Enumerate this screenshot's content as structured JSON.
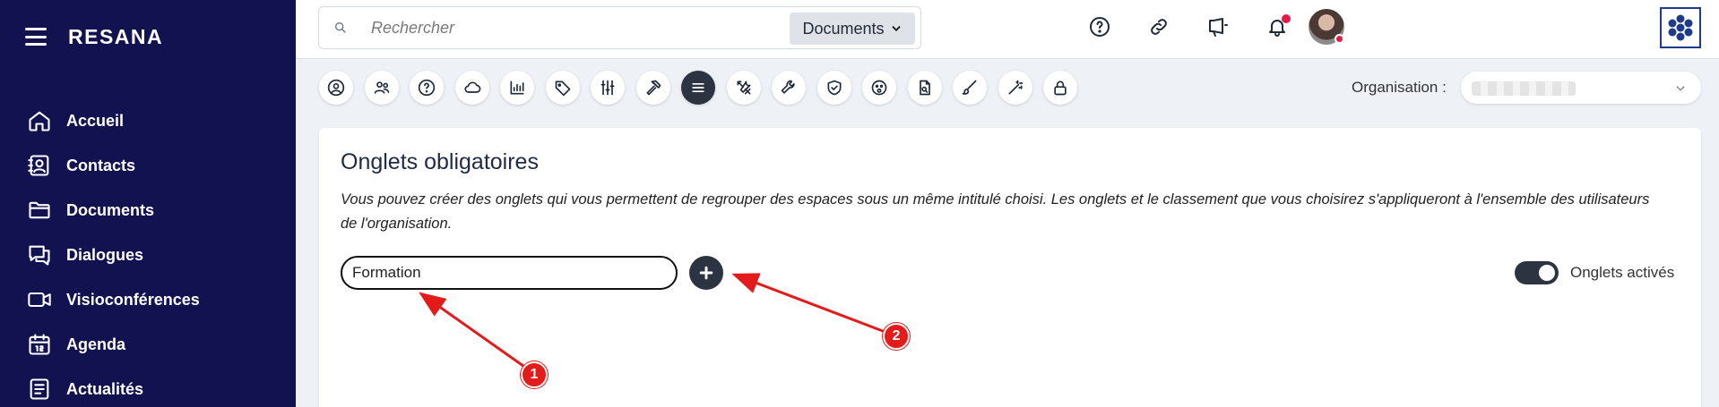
{
  "sidebar": {
    "brand": "RESANA",
    "items": [
      {
        "label": "Accueil",
        "icon": "home-icon"
      },
      {
        "label": "Contacts",
        "icon": "contacts-icon"
      },
      {
        "label": "Documents",
        "icon": "folder-icon"
      },
      {
        "label": "Dialogues",
        "icon": "chat-icon"
      },
      {
        "label": "Visioconférences",
        "icon": "video-icon"
      },
      {
        "label": "Agenda",
        "icon": "calendar-icon"
      },
      {
        "label": "Actualités",
        "icon": "news-icon"
      }
    ]
  },
  "topbar": {
    "search_placeholder": "Rechercher",
    "search_scope": "Documents",
    "icons": [
      "help-icon",
      "link-icon",
      "megaphone-icon",
      "bell-icon"
    ]
  },
  "toolbar": {
    "icons": [
      "user-icon",
      "users-icon",
      "help-icon",
      "cloud-icon",
      "chart-icon",
      "tag-icon",
      "sliders-icon",
      "hammer-icon",
      "list-icon",
      "tools-icon",
      "wrench-icon",
      "shield-check-icon",
      "face-icon",
      "file-search-icon",
      "brush-icon",
      "magic-wand-icon",
      "lock-icon"
    ],
    "active_index": 8
  },
  "organisation": {
    "label": "Organisation :"
  },
  "card": {
    "title": "Onglets obligatoires",
    "description": "Vous pouvez créer des onglets qui vous permettent de regrouper des espaces sous un même intitulé choisi. Les onglets et le classement que vous choisirez s'appliqueront à l'ensemble des utilisateurs de l'organisation.",
    "input_value": "Formation",
    "toggle_label": "Onglets activés",
    "toggle_on": true
  },
  "annotations": {
    "badge1": "1",
    "badge2": "2",
    "color": "#e41b1b"
  }
}
